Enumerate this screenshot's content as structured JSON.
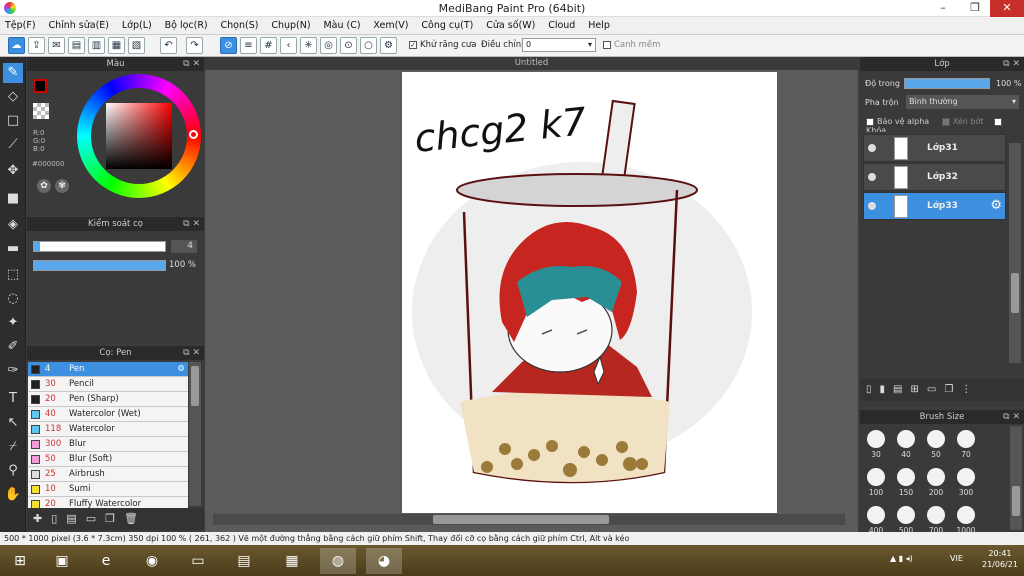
{
  "window": {
    "title": "MediBang Paint Pro (64bit)",
    "minimize": "–",
    "restore": "❐",
    "close": "✕"
  },
  "menu": [
    "Tệp(F)",
    "Chỉnh sửa(E)",
    "Lớp(L)",
    "Bộ lọc(R)",
    "Chọn(S)",
    "Chụp(N)",
    "Màu (C)",
    "Xem(V)",
    "Công cụ(T)",
    "Cửa số(W)",
    "Cloud",
    "Help"
  ],
  "toolbar": {
    "antialias_label": "Khử răng cưa",
    "antialias_checked": true,
    "adjust_label": "Điều chỉnh",
    "adjust_value": "0",
    "smooth_label": "Canh mềm",
    "smooth_checked": false
  },
  "color_panel": {
    "title": "Màu",
    "r": "R:0",
    "g": "G:0",
    "b": "B:0",
    "hex": "#000000",
    "primary_color": "#000000"
  },
  "brush_control": {
    "title": "Kiểm soát cọ",
    "size": "4",
    "opacity": "100 %"
  },
  "brush_list": {
    "title": "Cọ: Pen",
    "items": [
      {
        "size": "4",
        "name": "Pen",
        "color": "#222222",
        "selected": true
      },
      {
        "size": "30",
        "name": "Pencil",
        "color": "#222222"
      },
      {
        "size": "20",
        "name": "Pen (Sharp)",
        "color": "#222222"
      },
      {
        "size": "40",
        "name": "Watercolor (Wet)",
        "color": "#5cc8f0"
      },
      {
        "size": "118",
        "name": "Watercolor",
        "color": "#5cc8f0"
      },
      {
        "size": "300",
        "name": "Blur",
        "color": "#f59ad8"
      },
      {
        "size": "50",
        "name": "Blur (Soft)",
        "color": "#f59ad8"
      },
      {
        "size": "25",
        "name": "Airbrush",
        "color": "#dddddd"
      },
      {
        "size": "10",
        "name": "Sumi",
        "color": "#f5e030"
      },
      {
        "size": "20",
        "name": "Fluffy Watercolor",
        "color": "#f5e030"
      }
    ]
  },
  "canvas": {
    "tab_title": "Untitled",
    "handwriting": "chcg2 k7"
  },
  "layer_panel": {
    "title": "Lớp",
    "opacity_label": "Độ trong",
    "opacity_value": "100 %",
    "blend_label": "Pha trộn",
    "blend_value": "Bình thường",
    "protect_alpha": "Bảo vệ alpha",
    "clip": "Xén bớt",
    "lock": "Khóa",
    "layers": [
      {
        "name": "Lớp31",
        "selected": false
      },
      {
        "name": "Lớp32",
        "selected": false
      },
      {
        "name": "Lớp33",
        "selected": true
      }
    ]
  },
  "brush_size_panel": {
    "title": "Brush Size",
    "sizes": [
      "30",
      "40",
      "50",
      "70",
      "100",
      "150",
      "200",
      "300",
      "400",
      "500",
      "700",
      "1000"
    ]
  },
  "status": {
    "text": "500 * 1000 pixel   (3.6 * 7.3cm)   350 dpi   100 %   ( 261, 362 )   Vẽ một đường thẳng bằng cách giữ phím Shift, Thay đổi cỡ cọ bằng cách giữ phím Ctrl, Alt và kéo"
  },
  "taskbar": {
    "lang": "VIE",
    "time": "20:41",
    "date": "21/06/21"
  },
  "colors": {
    "accent": "#3d8fe0",
    "panel": "#3a3a3a",
    "close_red": "#c7302a"
  }
}
